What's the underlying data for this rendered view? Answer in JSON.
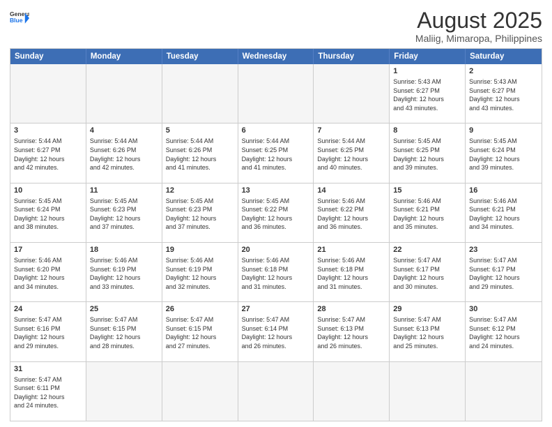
{
  "logo": {
    "general": "General",
    "blue": "Blue"
  },
  "header": {
    "title": "August 2025",
    "subtitle": "Maliig, Mimaropa, Philippines"
  },
  "weekdays": [
    "Sunday",
    "Monday",
    "Tuesday",
    "Wednesday",
    "Thursday",
    "Friday",
    "Saturday"
  ],
  "rows": [
    [
      {
        "day": "",
        "info": "",
        "empty": true
      },
      {
        "day": "",
        "info": "",
        "empty": true
      },
      {
        "day": "",
        "info": "",
        "empty": true
      },
      {
        "day": "",
        "info": "",
        "empty": true
      },
      {
        "day": "",
        "info": "",
        "empty": true
      },
      {
        "day": "1",
        "info": "Sunrise: 5:43 AM\nSunset: 6:27 PM\nDaylight: 12 hours\nand 43 minutes.",
        "empty": false
      },
      {
        "day": "2",
        "info": "Sunrise: 5:43 AM\nSunset: 6:27 PM\nDaylight: 12 hours\nand 43 minutes.",
        "empty": false
      }
    ],
    [
      {
        "day": "3",
        "info": "Sunrise: 5:44 AM\nSunset: 6:27 PM\nDaylight: 12 hours\nand 42 minutes.",
        "empty": false
      },
      {
        "day": "4",
        "info": "Sunrise: 5:44 AM\nSunset: 6:26 PM\nDaylight: 12 hours\nand 42 minutes.",
        "empty": false
      },
      {
        "day": "5",
        "info": "Sunrise: 5:44 AM\nSunset: 6:26 PM\nDaylight: 12 hours\nand 41 minutes.",
        "empty": false
      },
      {
        "day": "6",
        "info": "Sunrise: 5:44 AM\nSunset: 6:25 PM\nDaylight: 12 hours\nand 41 minutes.",
        "empty": false
      },
      {
        "day": "7",
        "info": "Sunrise: 5:44 AM\nSunset: 6:25 PM\nDaylight: 12 hours\nand 40 minutes.",
        "empty": false
      },
      {
        "day": "8",
        "info": "Sunrise: 5:45 AM\nSunset: 6:25 PM\nDaylight: 12 hours\nand 39 minutes.",
        "empty": false
      },
      {
        "day": "9",
        "info": "Sunrise: 5:45 AM\nSunset: 6:24 PM\nDaylight: 12 hours\nand 39 minutes.",
        "empty": false
      }
    ],
    [
      {
        "day": "10",
        "info": "Sunrise: 5:45 AM\nSunset: 6:24 PM\nDaylight: 12 hours\nand 38 minutes.",
        "empty": false
      },
      {
        "day": "11",
        "info": "Sunrise: 5:45 AM\nSunset: 6:23 PM\nDaylight: 12 hours\nand 37 minutes.",
        "empty": false
      },
      {
        "day": "12",
        "info": "Sunrise: 5:45 AM\nSunset: 6:23 PM\nDaylight: 12 hours\nand 37 minutes.",
        "empty": false
      },
      {
        "day": "13",
        "info": "Sunrise: 5:45 AM\nSunset: 6:22 PM\nDaylight: 12 hours\nand 36 minutes.",
        "empty": false
      },
      {
        "day": "14",
        "info": "Sunrise: 5:46 AM\nSunset: 6:22 PM\nDaylight: 12 hours\nand 36 minutes.",
        "empty": false
      },
      {
        "day": "15",
        "info": "Sunrise: 5:46 AM\nSunset: 6:21 PM\nDaylight: 12 hours\nand 35 minutes.",
        "empty": false
      },
      {
        "day": "16",
        "info": "Sunrise: 5:46 AM\nSunset: 6:21 PM\nDaylight: 12 hours\nand 34 minutes.",
        "empty": false
      }
    ],
    [
      {
        "day": "17",
        "info": "Sunrise: 5:46 AM\nSunset: 6:20 PM\nDaylight: 12 hours\nand 34 minutes.",
        "empty": false
      },
      {
        "day": "18",
        "info": "Sunrise: 5:46 AM\nSunset: 6:19 PM\nDaylight: 12 hours\nand 33 minutes.",
        "empty": false
      },
      {
        "day": "19",
        "info": "Sunrise: 5:46 AM\nSunset: 6:19 PM\nDaylight: 12 hours\nand 32 minutes.",
        "empty": false
      },
      {
        "day": "20",
        "info": "Sunrise: 5:46 AM\nSunset: 6:18 PM\nDaylight: 12 hours\nand 31 minutes.",
        "empty": false
      },
      {
        "day": "21",
        "info": "Sunrise: 5:46 AM\nSunset: 6:18 PM\nDaylight: 12 hours\nand 31 minutes.",
        "empty": false
      },
      {
        "day": "22",
        "info": "Sunrise: 5:47 AM\nSunset: 6:17 PM\nDaylight: 12 hours\nand 30 minutes.",
        "empty": false
      },
      {
        "day": "23",
        "info": "Sunrise: 5:47 AM\nSunset: 6:17 PM\nDaylight: 12 hours\nand 29 minutes.",
        "empty": false
      }
    ],
    [
      {
        "day": "24",
        "info": "Sunrise: 5:47 AM\nSunset: 6:16 PM\nDaylight: 12 hours\nand 29 minutes.",
        "empty": false
      },
      {
        "day": "25",
        "info": "Sunrise: 5:47 AM\nSunset: 6:15 PM\nDaylight: 12 hours\nand 28 minutes.",
        "empty": false
      },
      {
        "day": "26",
        "info": "Sunrise: 5:47 AM\nSunset: 6:15 PM\nDaylight: 12 hours\nand 27 minutes.",
        "empty": false
      },
      {
        "day": "27",
        "info": "Sunrise: 5:47 AM\nSunset: 6:14 PM\nDaylight: 12 hours\nand 26 minutes.",
        "empty": false
      },
      {
        "day": "28",
        "info": "Sunrise: 5:47 AM\nSunset: 6:13 PM\nDaylight: 12 hours\nand 26 minutes.",
        "empty": false
      },
      {
        "day": "29",
        "info": "Sunrise: 5:47 AM\nSunset: 6:13 PM\nDaylight: 12 hours\nand 25 minutes.",
        "empty": false
      },
      {
        "day": "30",
        "info": "Sunrise: 5:47 AM\nSunset: 6:12 PM\nDaylight: 12 hours\nand 24 minutes.",
        "empty": false
      }
    ],
    [
      {
        "day": "31",
        "info": "Sunrise: 5:47 AM\nSunset: 6:11 PM\nDaylight: 12 hours\nand 24 minutes.",
        "empty": false
      },
      {
        "day": "",
        "info": "",
        "empty": true
      },
      {
        "day": "",
        "info": "",
        "empty": true
      },
      {
        "day": "",
        "info": "",
        "empty": true
      },
      {
        "day": "",
        "info": "",
        "empty": true
      },
      {
        "day": "",
        "info": "",
        "empty": true
      },
      {
        "day": "",
        "info": "",
        "empty": true
      }
    ]
  ]
}
